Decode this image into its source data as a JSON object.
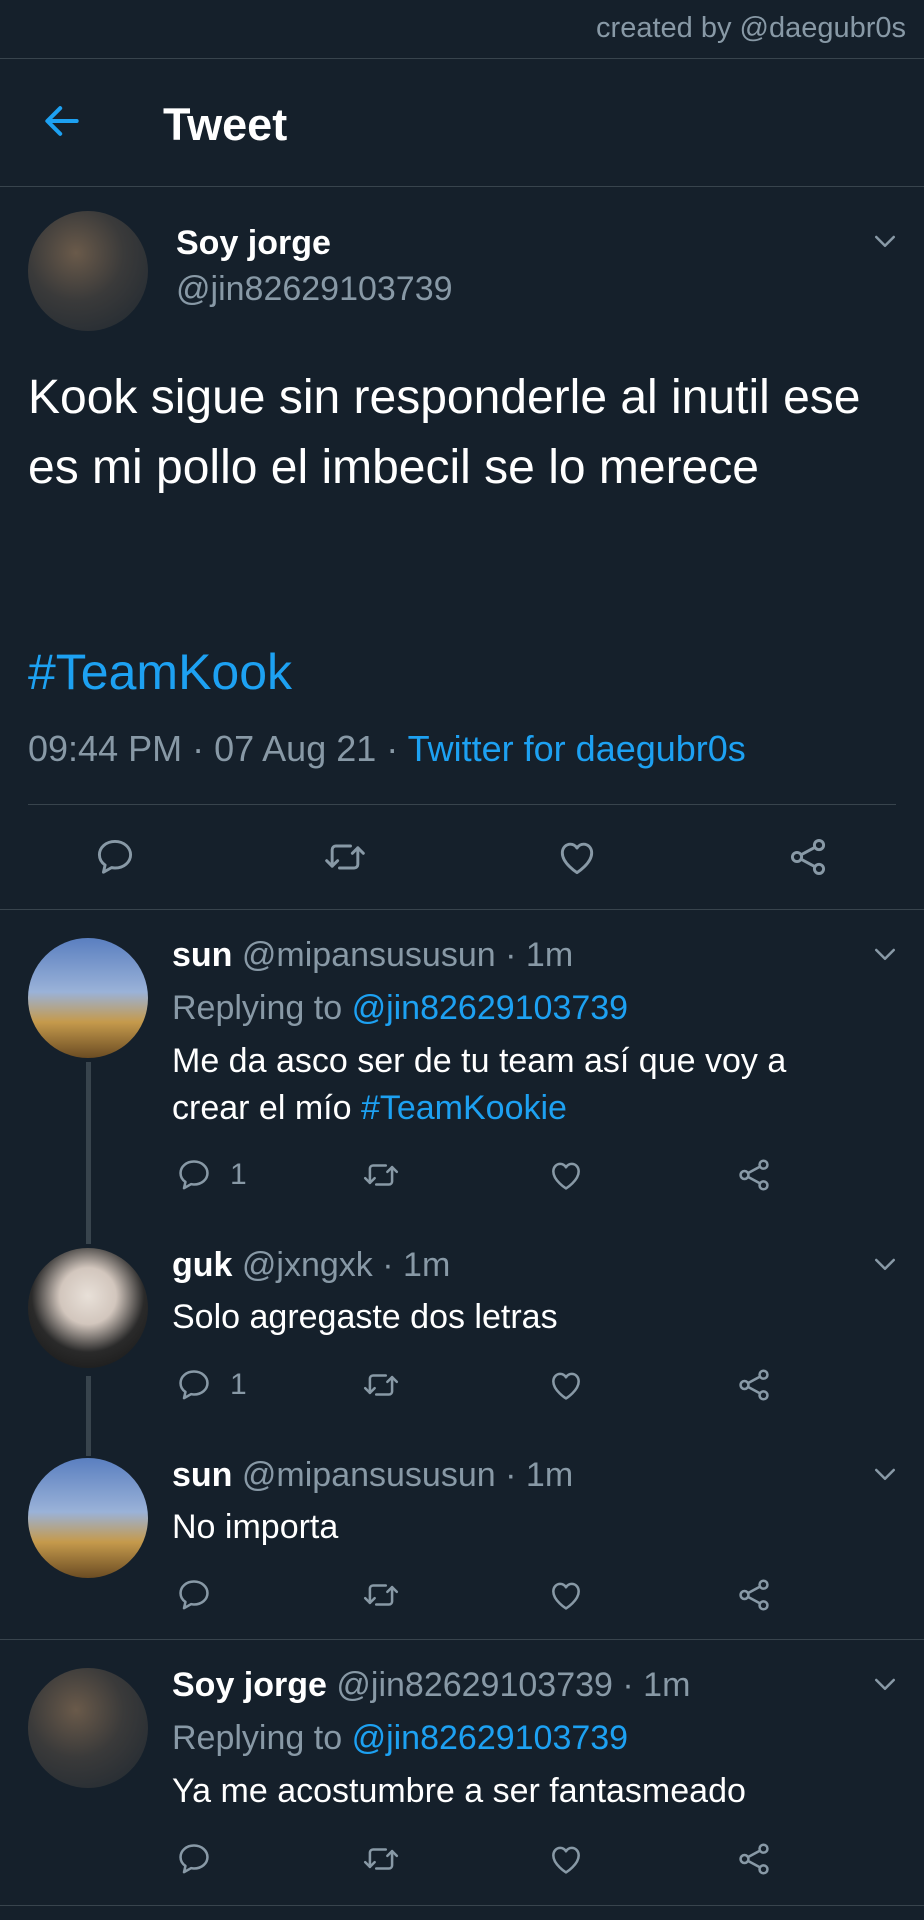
{
  "watermark": "created by @daegubr0s",
  "header": {
    "title": "Tweet"
  },
  "tweet": {
    "name": "Soy jorge",
    "handle": "@jin82629103739",
    "text": "Kook sigue sin responderle al inutil ese es mi pollo el imbecil se lo merece",
    "hashtag": "#TeamKook",
    "time": "09:44 PM",
    "date": "07 Aug 21",
    "source": "Twitter for daegubr0s"
  },
  "replies": [
    {
      "name": "sun",
      "handle": "@mipansususun",
      "time": "1m",
      "replying_label": "Replying to",
      "replying_to": "@jin82629103739",
      "text": "Me da asco ser de tu team así que voy a crear el mío",
      "hashtag": "#TeamKookie",
      "reply_count": "1"
    },
    {
      "name": "guk",
      "handle": "@jxngxk",
      "time": "1m",
      "text": "Solo agregaste dos letras",
      "reply_count": "1"
    },
    {
      "name": "sun",
      "handle": "@mipansususun",
      "time": "1m",
      "text": "No importa"
    },
    {
      "name": "Soy jorge",
      "handle": "@jin82629103739",
      "time": "1m",
      "replying_label": "Replying to",
      "replying_to": "@jin82629103739",
      "text": "Ya me acostumbre a ser fantasmeado"
    }
  ],
  "colors": {
    "background": "#15202b",
    "accent": "#1da1f2",
    "muted": "#8899a6",
    "divider": "#38444d"
  },
  "icons": [
    "back-arrow-icon",
    "chevron-down-icon",
    "reply-icon",
    "retweet-icon",
    "like-icon",
    "share-icon"
  ]
}
